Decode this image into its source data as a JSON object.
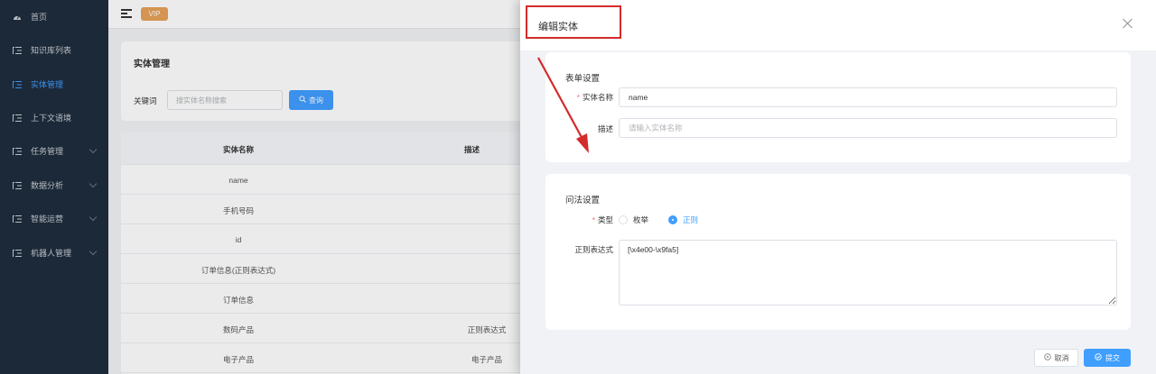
{
  "sidebar": {
    "items": [
      {
        "label": "首页",
        "icon": "dashboard-icon",
        "active": false,
        "has_children": false
      },
      {
        "label": "知识库列表",
        "icon": "list-icon",
        "active": false,
        "has_children": false
      },
      {
        "label": "实体管理",
        "icon": "list-icon",
        "active": true,
        "has_children": false
      },
      {
        "label": "上下文语境",
        "icon": "list-icon",
        "active": false,
        "has_children": false
      },
      {
        "label": "任务管理",
        "icon": "list-icon",
        "active": false,
        "has_children": true
      },
      {
        "label": "数据分析",
        "icon": "list-icon",
        "active": false,
        "has_children": true
      },
      {
        "label": "智能运营",
        "icon": "list-icon",
        "active": false,
        "has_children": true
      },
      {
        "label": "机器人管理",
        "icon": "list-icon",
        "active": false,
        "has_children": true
      }
    ]
  },
  "header": {
    "badge": "VIP"
  },
  "page": {
    "title": "实体管理",
    "search": {
      "label": "关键词",
      "placeholder": "搜实体名称搜索",
      "value": ""
    },
    "query_button": "查询",
    "table": {
      "columns": [
        "实体名称",
        "描述"
      ],
      "rows": [
        [
          "name",
          ""
        ],
        [
          "手机号码",
          ""
        ],
        [
          "id",
          ""
        ],
        [
          "订单信息(正则表达式)",
          ""
        ],
        [
          "订单信息",
          ""
        ],
        [
          "数码产品",
          "正则表达式"
        ],
        [
          "电子产品",
          "电子产品"
        ]
      ]
    }
  },
  "drawer": {
    "title": "编辑实体",
    "form_section": {
      "title": "表单设置",
      "name_label": "实体名称",
      "name_value": "name",
      "desc_label": "描述",
      "desc_placeholder": "请输入实体名称",
      "desc_value": ""
    },
    "method_section": {
      "title": "问法设置",
      "type_label": "类型",
      "options": [
        "枚举",
        "正则"
      ],
      "selected": "正则",
      "regex_label": "正则表达式",
      "regex_value": "[\\x4e00-\\x9fa5]"
    },
    "cancel_button": "取消",
    "submit_button": "提交"
  },
  "colors": {
    "primary": "#409eff",
    "sidebar_bg": "#1f2d3d",
    "required": "#f56c6c",
    "annotation": "#d42b2b",
    "vip": "#e7a15a"
  }
}
